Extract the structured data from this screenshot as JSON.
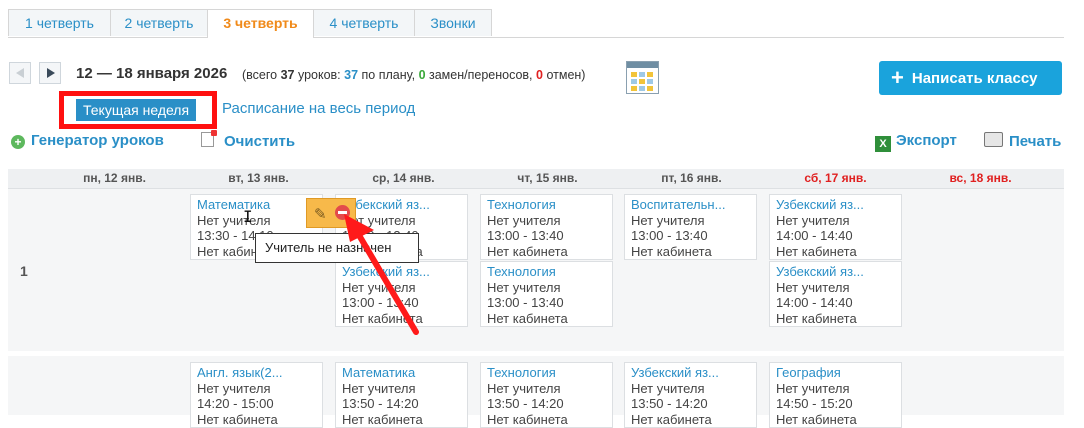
{
  "tabs": [
    "1 четверть",
    "2 четверть",
    "3 четверть",
    "4 четверть",
    "Звонки"
  ],
  "active_tab": "3 четверть",
  "week": {
    "title": "12 — 18 января 2026",
    "stats_prefix": "(всего ",
    "total": "37",
    "after_total": " уроков: ",
    "planned": "37",
    "after_planned": " по плану, ",
    "replacements": "0",
    "after_replacements": " замен/переносов, ",
    "cancelled": "0",
    "after_cancelled": " отмен)"
  },
  "buttons": {
    "write_class": "Написать классу",
    "current_week": "Текущая неделя",
    "whole_period": "Расписание на весь период",
    "generator": "Генератор уроков",
    "clear": "Очистить",
    "export": "Экспорт",
    "print": "Печать"
  },
  "days": [
    "пн, 12 янв.",
    "вт, 13 янв.",
    "ср, 14 янв.",
    "чт, 15 янв.",
    "пт, 16 янв.",
    "сб, 17 янв.",
    "вс, 18 янв."
  ],
  "rows": [
    {
      "num": "1"
    }
  ],
  "cards": [
    {
      "subject": "Математика",
      "teacher": "Нет учителя",
      "time": "13:30 - 14:10",
      "room": "Нет кабинета"
    },
    {
      "subject": "Узбекский яз...",
      "teacher": "Нет учителя",
      "time": "13:00 - 13:40",
      "room": "Нет кабинета"
    },
    {
      "subject": "Узбекский яз...",
      "teacher": "Нет учителя",
      "time": "13:00 - 13:40",
      "room": "Нет кабинета"
    },
    {
      "subject": "Технология",
      "teacher": "Нет учителя",
      "time": "13:00 - 13:40",
      "room": "Нет кабинета"
    },
    {
      "subject": "Технология",
      "teacher": "Нет учителя",
      "time": "13:00 - 13:40",
      "room": "Нет кабинета"
    },
    {
      "subject": "Воспитательн...",
      "teacher": "Нет учителя",
      "time": "13:00 - 13:40",
      "room": "Нет кабинета"
    },
    {
      "subject": "Узбекский яз...",
      "teacher": "Нет учителя",
      "time": "14:00 - 14:40",
      "room": "Нет кабинета"
    },
    {
      "subject": "Узбекский яз...",
      "teacher": "Нет учителя",
      "time": "14:00 - 14:40",
      "room": "Нет кабинета"
    },
    {
      "subject": "Англ. язык(2...",
      "teacher": "Нет учителя",
      "time": "14:20 - 15:00",
      "room": "Нет кабинета"
    },
    {
      "subject": "Математика",
      "teacher": "Нет учителя",
      "time": "13:50 - 14:20",
      "room": "Нет кабинета"
    },
    {
      "subject": "Технология",
      "teacher": "Нет учителя",
      "time": "13:50 - 14:20",
      "room": "Нет кабинета"
    },
    {
      "subject": "Узбекский яз...",
      "teacher": "Нет учителя",
      "time": "13:50 - 14:20",
      "room": "Нет кабинета"
    },
    {
      "subject": "География",
      "teacher": "Нет учителя",
      "time": "14:50 - 15:20",
      "room": "Нет кабинета"
    }
  ],
  "tooltip": "Учитель не назначен",
  "colors": {
    "accent": "#2a8fc7",
    "active_tab": "#f08a1a",
    "weekend": "#e02020",
    "highlight": "#ff1010",
    "button": "#1aa3dc"
  }
}
